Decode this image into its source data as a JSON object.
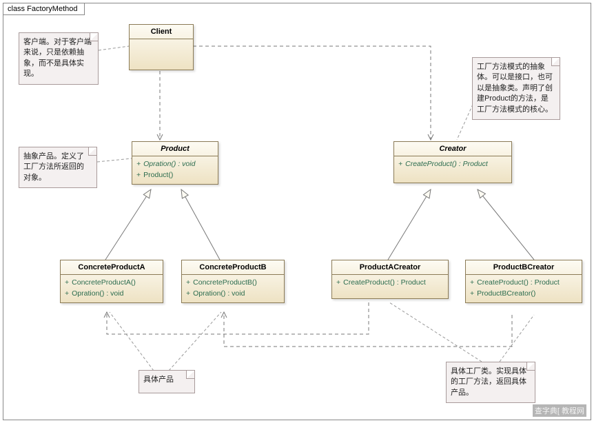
{
  "diagram": {
    "frame_title": "class FactoryMethod",
    "watermark": "查字典[ 教程网"
  },
  "notes": {
    "client": "客户端。对于客户端来说，只是依赖抽象，而不是具体实现。",
    "product": "抽象产品。定义了工厂方法所返回的对象。",
    "creator": "工厂方法模式的抽象体。可以是接口，也可以是抽象类。声明了创建Product的方法，是工厂方法模式的核心。",
    "concrete_products": "具体产品",
    "concrete_creators": "具体工厂类。实现具体的工厂方法，返回具体产品。"
  },
  "classes": {
    "client": {
      "name": "Client"
    },
    "product": {
      "name": "Product",
      "ops": [
        "Opration() : void",
        "Product()"
      ]
    },
    "creator": {
      "name": "Creator",
      "ops": [
        "CreateProduct() : Product"
      ]
    },
    "concreteA": {
      "name": "ConcreteProductA",
      "ops": [
        "ConcreteProductA()",
        "Opration() : void"
      ]
    },
    "concreteB": {
      "name": "ConcreteProductB",
      "ops": [
        "ConcreteProductB()",
        "Opration() : void"
      ]
    },
    "creatorA": {
      "name": "ProductACreator",
      "ops": [
        "CreateProduct() : Product"
      ]
    },
    "creatorB": {
      "name": "ProductBCreator",
      "ops": [
        "CreateProduct() : Product",
        "ProductBCreator()"
      ]
    }
  }
}
